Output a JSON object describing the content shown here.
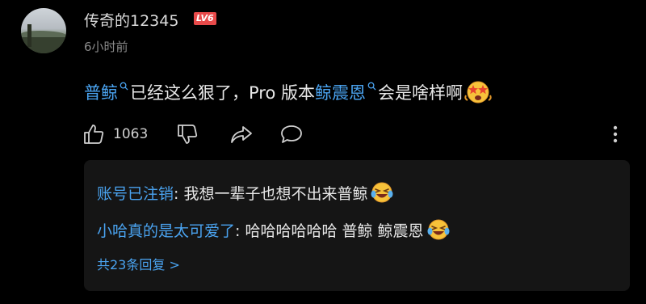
{
  "comment": {
    "username": "传奇的12345",
    "level_badge": "LV6",
    "time": "6小时前",
    "text": {
      "link1": "普鲸",
      "part1": "已经这么狠了，Pro 版本",
      "link2": "鲸震恩",
      "part2": "会是啥样啊"
    },
    "emoji": "star-eyes-face-icon",
    "likes": "1063"
  },
  "replies": [
    {
      "author": "账号已注销",
      "sep": ": ",
      "text": "我想一辈子也想不出来普鲸",
      "emoji": "laughing-tears-face-icon"
    },
    {
      "author": "小哈真的是太可爱了",
      "sep": ": ",
      "text": "哈哈哈哈哈哈 普鲸 鲸震恩",
      "emoji": "laughing-tears-face-icon"
    }
  ],
  "more_replies": "共23条回复 >",
  "colors": {
    "background": "#000000",
    "link": "#4aa3f0",
    "badge": "#e84a4a",
    "reply_panel": "#151515"
  }
}
